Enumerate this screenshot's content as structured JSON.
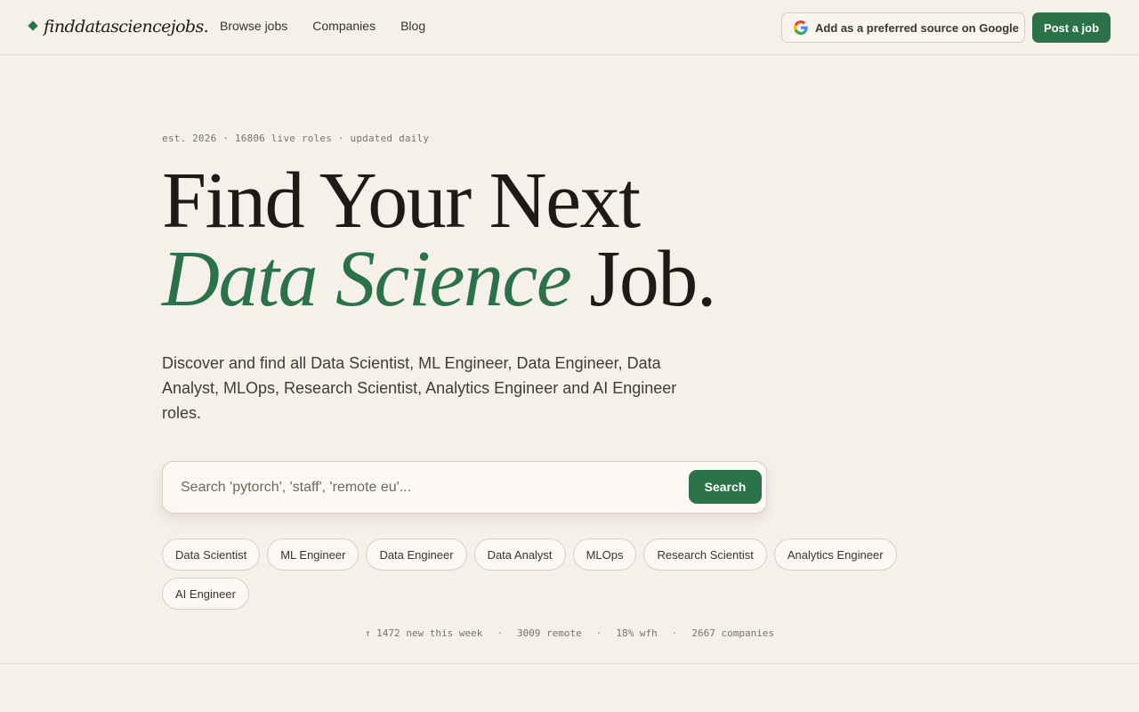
{
  "header": {
    "logo_text": "finddatasciencejobs.",
    "nav": [
      "Browse jobs",
      "Companies",
      "Blog"
    ],
    "google_source_label": "Add as a preferred source on Google",
    "post_job_label": "Post a job"
  },
  "hero": {
    "meta": "est. 2026 · 16806 live roles · updated daily",
    "title_line1": "Find Your Next",
    "title_accent": "Data Science",
    "title_end": " Job.",
    "description": "Discover and find all Data Scientist, ML Engineer, Data Engineer, Data Analyst, MLOps, Research Scientist, Analytics Engineer and AI Engineer roles."
  },
  "search": {
    "placeholder": "Search 'pytorch', 'staff', 'remote eu'...",
    "value": "",
    "button_label": "Search"
  },
  "chips": [
    "Data Scientist",
    "ML Engineer",
    "Data Engineer",
    "Data Analyst",
    "MLOps",
    "Research Scientist",
    "Analytics Engineer",
    "AI Engineer"
  ],
  "stats": {
    "new_this_week": "↑ 1472 new this week",
    "remote": "3009 remote",
    "wfh": "18% wfh",
    "companies": "2667 companies",
    "separator": "·"
  },
  "colors": {
    "accent": "#2b7249",
    "background": "#f5f0e9"
  }
}
